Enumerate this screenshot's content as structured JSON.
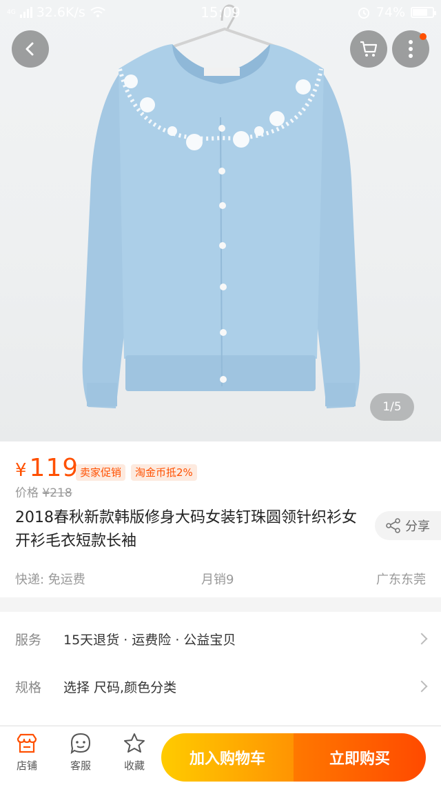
{
  "status_bar": {
    "network": "4G",
    "speed": "32.6K/s",
    "time": "15:09",
    "battery": "74%",
    "battery_level": 0.74
  },
  "product_image": {
    "page_indicator": "1/5"
  },
  "product": {
    "currency": "¥",
    "price": "119",
    "tags": [
      "卖家促销",
      "淘金币抵2%"
    ],
    "old_price_label": "价格",
    "old_price": "¥218",
    "title": "2018春秋新款韩版修身大码女装钉珠圆领针织衫女开衫毛衣短款长袖",
    "share_label": "分享",
    "shipping": "快递: 免运费",
    "monthly_sales": "月销9",
    "location": "广东东莞"
  },
  "services": {
    "service_label": "服务",
    "service_value": "15天退货 · 运费险 · 公益宝贝",
    "spec_label": "规格",
    "spec_value": "选择 尺码,颜色分类"
  },
  "bottom_bar": {
    "shop": "店铺",
    "service": "客服",
    "favorite": "收藏",
    "add_to_cart": "加入购物车",
    "buy_now": "立即购买"
  },
  "colors": {
    "accent": "#ff5000",
    "cart_button": "#ffa000",
    "buy_button": "#ff5500",
    "sweater": "#a9cce6"
  },
  "icons": [
    "back-icon",
    "cart-icon",
    "more-icon",
    "share-icon",
    "shop-icon",
    "customer-service-icon",
    "star-icon",
    "chevron-right-icon"
  ]
}
